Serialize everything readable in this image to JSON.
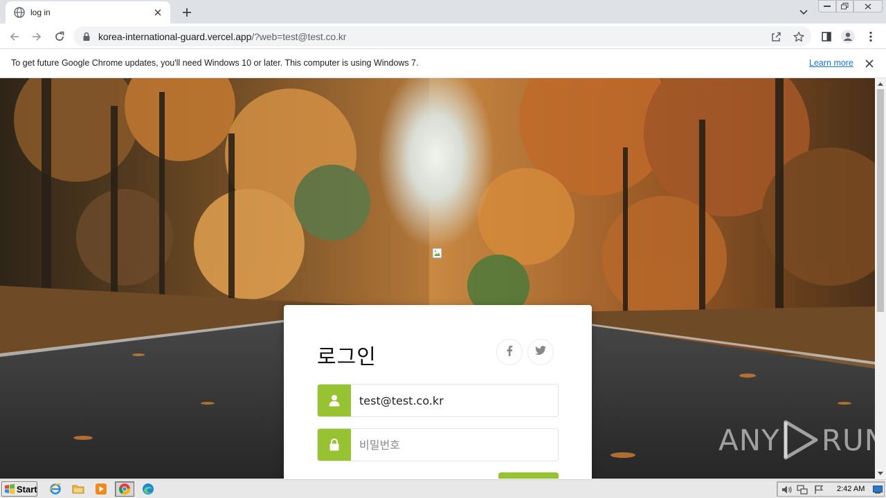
{
  "browser": {
    "tab_title": "log in",
    "url_host": "korea-international-guard.vercel.app",
    "url_query": "/?web=test@test.co.kr"
  },
  "infobar": {
    "message": "To get future Google Chrome updates, you'll need Windows 10 or later. This computer is using Windows 7.",
    "link_label": "Learn more"
  },
  "login": {
    "heading": "로그인",
    "email_value": "test@test.co.kr",
    "password_placeholder": "비밀번호",
    "accent_color": "#97c231"
  },
  "watermark": {
    "left_text": "ANY",
    "right_text": "RUN"
  },
  "taskbar": {
    "start_label": "Start",
    "clock": "2:42 AM"
  },
  "icons": {
    "tab": [
      "globe-icon",
      "close-icon",
      "plus-icon",
      "chevron-down-icon"
    ],
    "toolbar": [
      "back-icon",
      "forward-icon",
      "reload-icon",
      "lock-icon",
      "share-icon",
      "star-icon",
      "side-panel-icon",
      "profile-icon",
      "kebab-menu-icon"
    ],
    "login": [
      "facebook-icon",
      "twitter-icon",
      "user-icon",
      "padlock-icon",
      "broken-image-icon"
    ],
    "taskbar": [
      "windows-flag-icon",
      "ie-icon",
      "folder-icon",
      "media-player-icon",
      "chrome-icon",
      "edge-icon",
      "speaker-icon",
      "network-icon",
      "action-center-flag-icon",
      "notification-icon"
    ]
  }
}
